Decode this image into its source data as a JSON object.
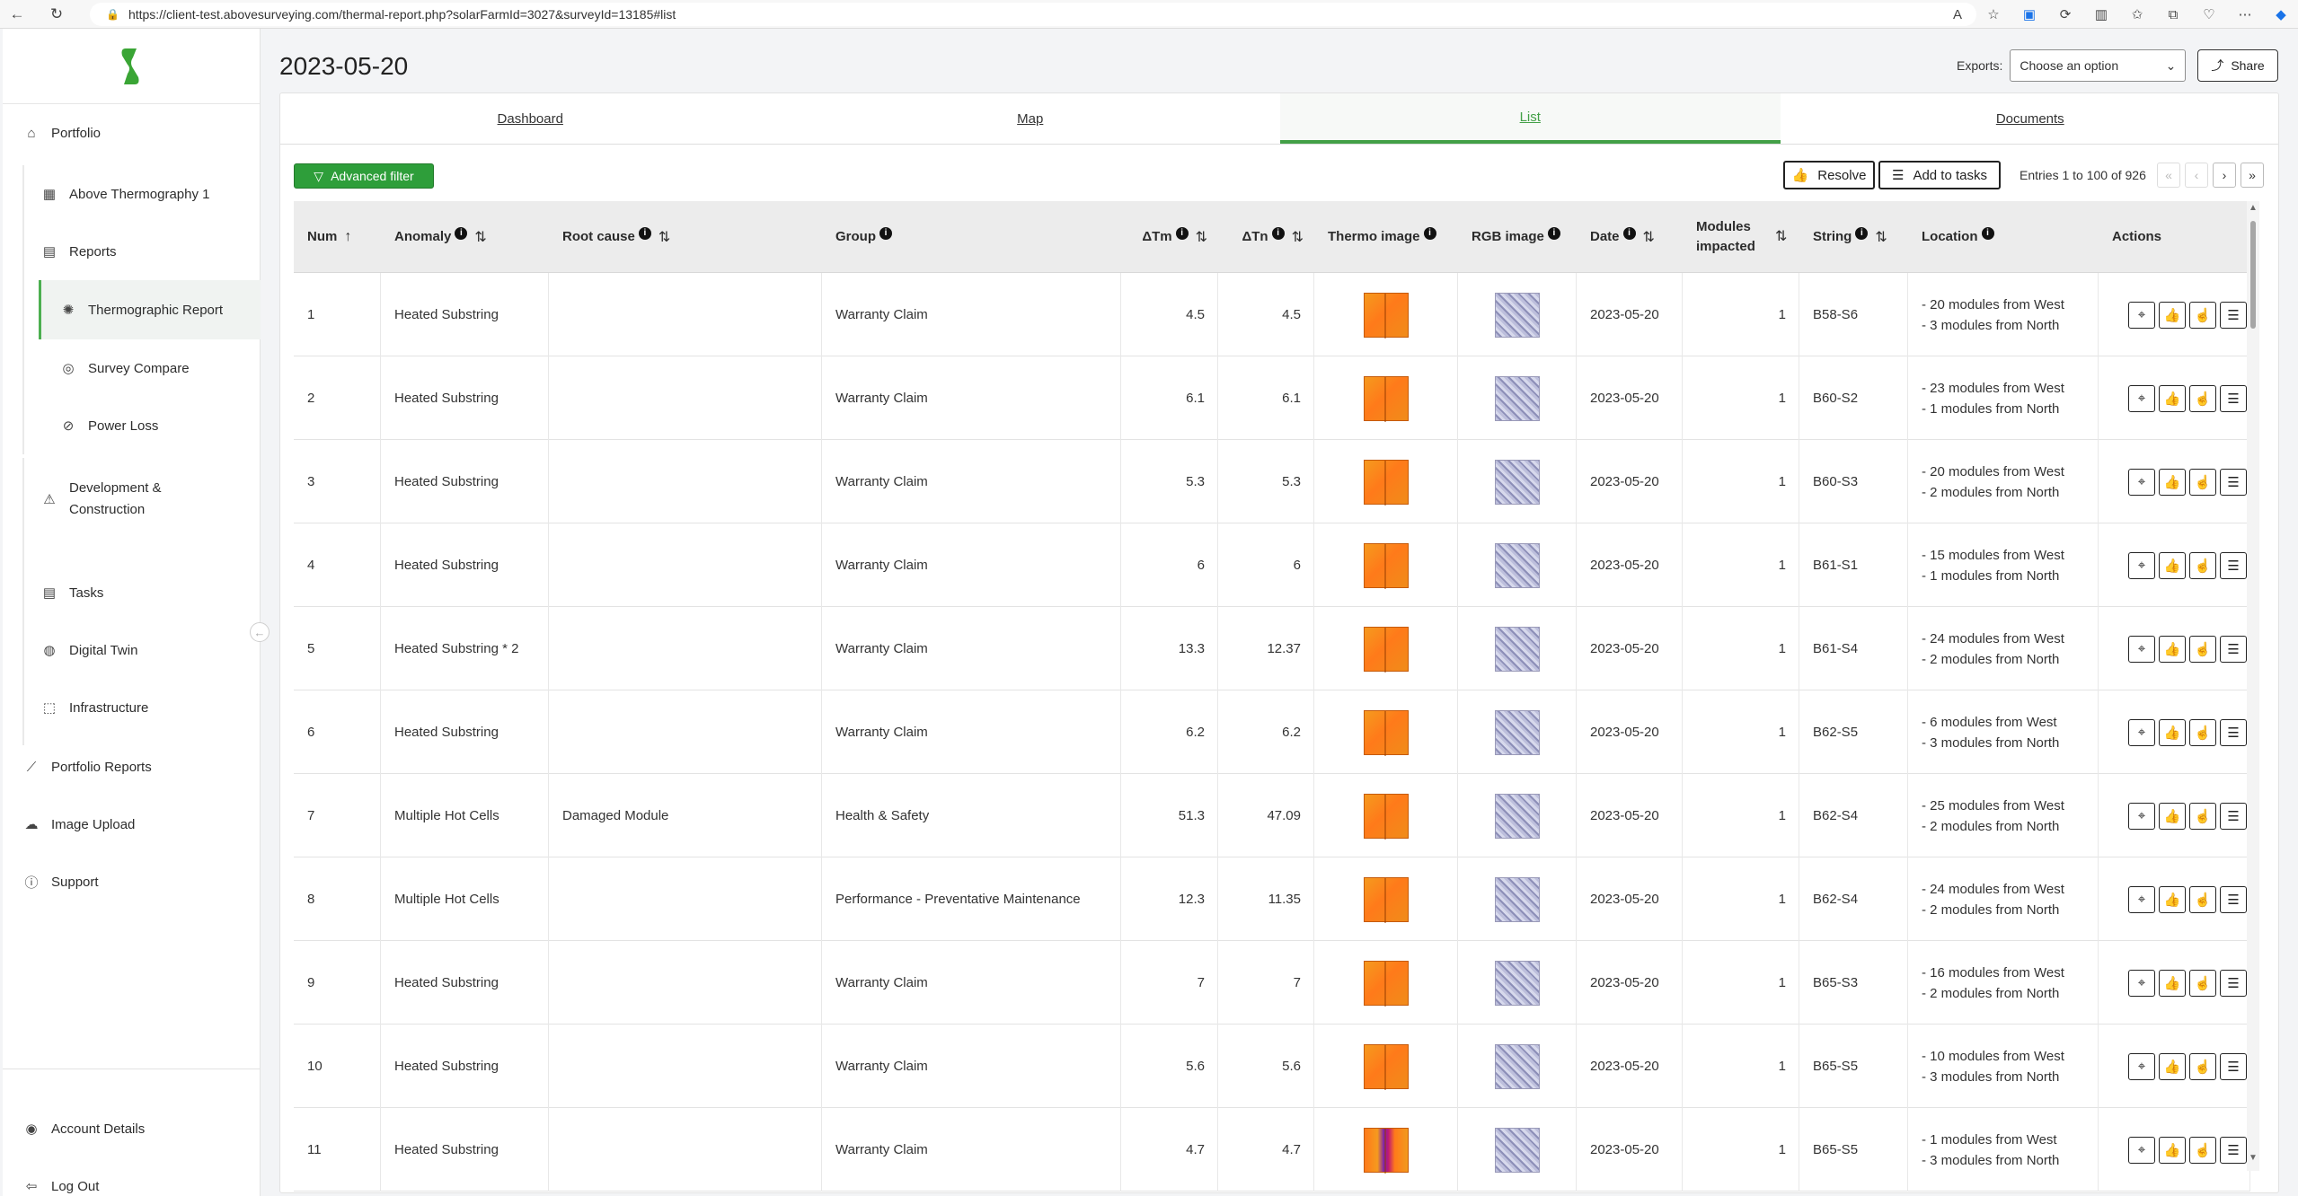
{
  "browser": {
    "url": "https://client-test.abovesurveying.com/thermal-report.php?solarFarmId=3027&surveyId=13185#list"
  },
  "sidebar": {
    "items": [
      {
        "label": "Portfolio",
        "icon": "home-icon"
      },
      {
        "label": "Above Thermography 1",
        "icon": "solar-panel-icon"
      },
      {
        "label": "Reports",
        "icon": "calendar-check-icon"
      },
      {
        "label": "Thermographic Report",
        "icon": "sun-icon"
      },
      {
        "label": "Survey Compare",
        "icon": "target-icon"
      },
      {
        "label": "Power Loss",
        "icon": "battery-slash-icon"
      },
      {
        "label": "Development & Construction",
        "icon": "warning-icon"
      },
      {
        "label": "Tasks",
        "icon": "list-table-icon"
      },
      {
        "label": "Digital Twin",
        "icon": "globe-icon"
      },
      {
        "label": "Infrastructure",
        "icon": "vector-square-icon"
      },
      {
        "label": "Portfolio Reports",
        "icon": "chart-line-icon"
      },
      {
        "label": "Image Upload",
        "icon": "cloud-upload-icon"
      },
      {
        "label": "Support",
        "icon": "info-icon"
      },
      {
        "label": "Account Details",
        "icon": "user-circle-icon"
      },
      {
        "label": "Log Out",
        "icon": "logout-icon"
      }
    ]
  },
  "header": {
    "title": "2023-05-20",
    "exports_label": "Exports:",
    "exports_value": "Choose an option",
    "share_label": "Share"
  },
  "tabs": [
    "Dashboard",
    "Map",
    "List",
    "Documents"
  ],
  "toolbar": {
    "advanced_filter": "Advanced filter",
    "resolve": "Resolve",
    "add_to_tasks": "Add to tasks",
    "entries": "Entries 1 to 100 of 926",
    "pager": [
      "«",
      "‹",
      "›",
      "»"
    ]
  },
  "columns": [
    "Num",
    "Anomaly",
    "Root cause",
    "Group",
    "ΔTm",
    "ΔTn",
    "Thermo image",
    "RGB image",
    "Date",
    "Modules impacted",
    "String",
    "Location",
    "Actions"
  ],
  "rows": [
    {
      "num": "1",
      "anomaly": "Heated Substring",
      "root": "",
      "group": "Warranty Claim",
      "dtm": "4.5",
      "dtn": "4.5",
      "date": "2023-05-20",
      "mods": "1",
      "string": "B58-S6",
      "loc1": "- 20 modules from West",
      "loc2": "- 3 modules from North",
      "thermo": "orange"
    },
    {
      "num": "2",
      "anomaly": "Heated Substring",
      "root": "",
      "group": "Warranty Claim",
      "dtm": "6.1",
      "dtn": "6.1",
      "date": "2023-05-20",
      "mods": "1",
      "string": "B60-S2",
      "loc1": "- 23 modules from West",
      "loc2": "- 1 modules from North",
      "thermo": "orange"
    },
    {
      "num": "3",
      "anomaly": "Heated Substring",
      "root": "",
      "group": "Warranty Claim",
      "dtm": "5.3",
      "dtn": "5.3",
      "date": "2023-05-20",
      "mods": "1",
      "string": "B60-S3",
      "loc1": "- 20 modules from West",
      "loc2": "- 2 modules from North",
      "thermo": "orange"
    },
    {
      "num": "4",
      "anomaly": "Heated Substring",
      "root": "",
      "group": "Warranty Claim",
      "dtm": "6",
      "dtn": "6",
      "date": "2023-05-20",
      "mods": "1",
      "string": "B61-S1",
      "loc1": "- 15 modules from West",
      "loc2": "- 1 modules from North",
      "thermo": "orange"
    },
    {
      "num": "5",
      "anomaly": "Heated Substring * 2",
      "root": "",
      "group": "Warranty Claim",
      "dtm": "13.3",
      "dtn": "12.37",
      "date": "2023-05-20",
      "mods": "1",
      "string": "B61-S4",
      "loc1": "- 24 modules from West",
      "loc2": "- 2 modules from North",
      "thermo": "orange"
    },
    {
      "num": "6",
      "anomaly": "Heated Substring",
      "root": "",
      "group": "Warranty Claim",
      "dtm": "6.2",
      "dtn": "6.2",
      "date": "2023-05-20",
      "mods": "1",
      "string": "B62-S5",
      "loc1": "- 6 modules from West",
      "loc2": "- 3 modules from North",
      "thermo": "orange"
    },
    {
      "num": "7",
      "anomaly": "Multiple Hot Cells",
      "root": "Damaged Module",
      "group": "Health & Safety",
      "dtm": "51.3",
      "dtn": "47.09",
      "date": "2023-05-20",
      "mods": "1",
      "string": "B62-S4",
      "loc1": "- 25 modules from West",
      "loc2": "- 2 modules from North",
      "thermo": "orange"
    },
    {
      "num": "8",
      "anomaly": "Multiple Hot Cells",
      "root": "",
      "group": "Performance - Preventative Maintenance",
      "dtm": "12.3",
      "dtn": "11.35",
      "date": "2023-05-20",
      "mods": "1",
      "string": "B62-S4",
      "loc1": "- 24 modules from West",
      "loc2": "- 2 modules from North",
      "thermo": "orange"
    },
    {
      "num": "9",
      "anomaly": "Heated Substring",
      "root": "",
      "group": "Warranty Claim",
      "dtm": "7",
      "dtn": "7",
      "date": "2023-05-20",
      "mods": "1",
      "string": "B65-S3",
      "loc1": "- 16 modules from West",
      "loc2": "- 2 modules from North",
      "thermo": "orange"
    },
    {
      "num": "10",
      "anomaly": "Heated Substring",
      "root": "",
      "group": "Warranty Claim",
      "dtm": "5.6",
      "dtn": "5.6",
      "date": "2023-05-20",
      "mods": "1",
      "string": "B65-S5",
      "loc1": "- 10 modules from West",
      "loc2": "- 3 modules from North",
      "thermo": "orange"
    },
    {
      "num": "11",
      "anomaly": "Heated Substring",
      "root": "",
      "group": "Warranty Claim",
      "dtm": "4.7",
      "dtn": "4.7",
      "date": "2023-05-20",
      "mods": "1",
      "string": "B65-S5",
      "loc1": "- 1 modules from West",
      "loc2": "- 3 modules from North",
      "thermo": "purple"
    }
  ],
  "colors": {
    "accent": "#43a047",
    "filter_button": "#2e9e3a"
  }
}
